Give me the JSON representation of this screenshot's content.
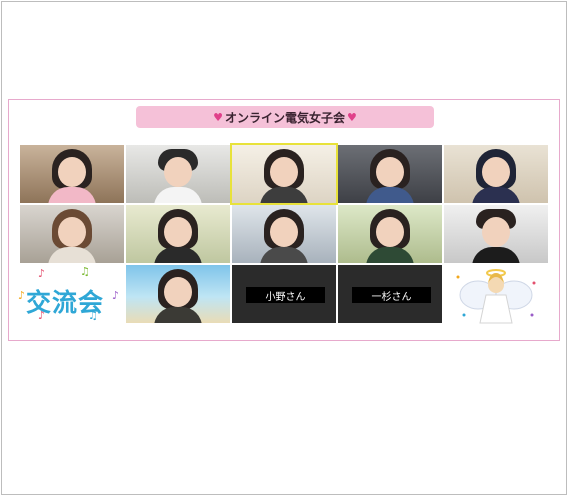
{
  "header": {
    "title": "オンライン電気女子会",
    "heart_color": "#e0408a"
  },
  "tiles": {
    "label_ono": "小野さん",
    "label_ichisugi": "一杉さん",
    "logo_text": "交流会"
  }
}
